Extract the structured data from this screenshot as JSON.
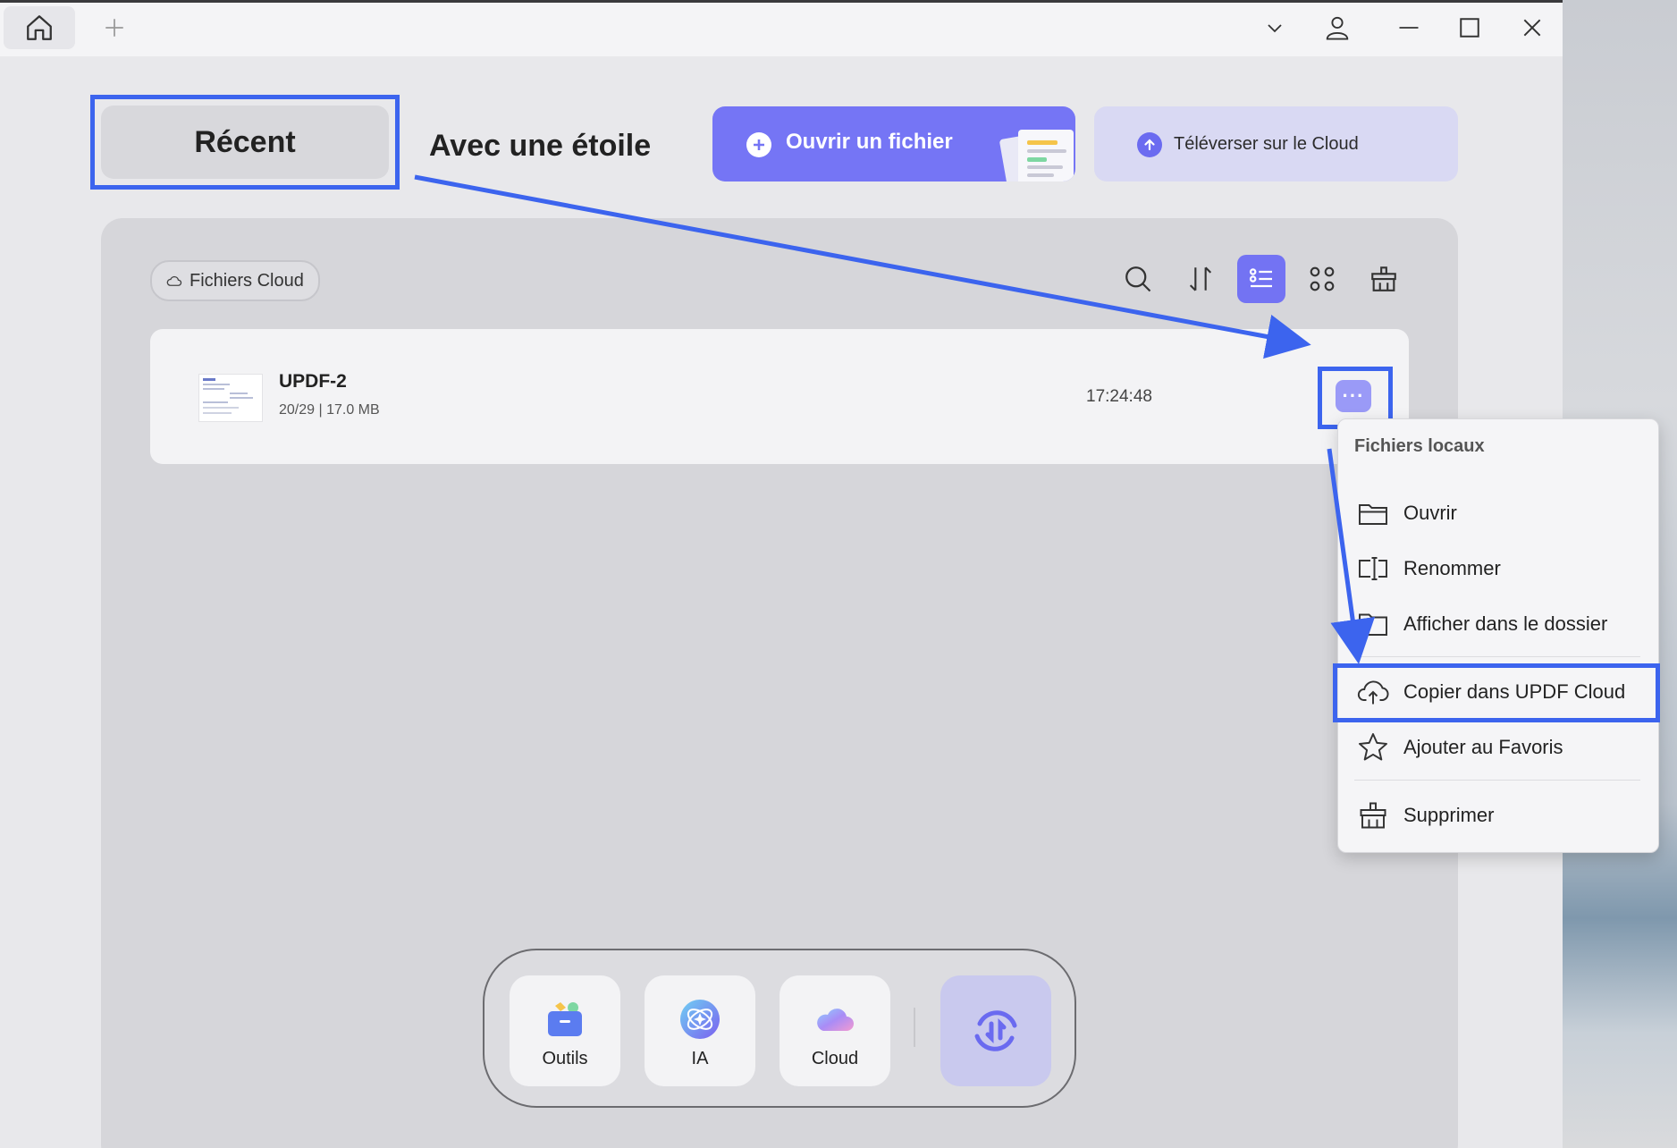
{
  "tabs": {
    "recent": "Récent",
    "starred": "Avec une étoile"
  },
  "actions": {
    "open_file": "Ouvrir un fichier",
    "upload_cloud": "Téléverser sur le Cloud"
  },
  "filter_chip": "Fichiers Cloud",
  "toolbar": {
    "icons": [
      "search-icon",
      "sort-icon",
      "list-view-icon",
      "grid-view-icon",
      "clear-icon"
    ],
    "active_view": "list"
  },
  "files": [
    {
      "name": "UPDF-2",
      "meta": "20/29 | 17.0 MB",
      "time": "17:24:48",
      "more_label": "···"
    }
  ],
  "context_menu": {
    "header": "Fichiers locaux",
    "items": [
      {
        "label": "Ouvrir",
        "icon": "folder-open-icon"
      },
      {
        "label": "Renommer",
        "icon": "rename-icon"
      },
      {
        "label": "Afficher dans le dossier",
        "icon": "folder-icon"
      },
      {
        "label": "Copier dans UPDF Cloud",
        "icon": "cloud-upload-icon"
      },
      {
        "label": "Ajouter au Favoris",
        "icon": "star-icon"
      },
      {
        "label": "Supprimer",
        "icon": "trash-icon"
      }
    ],
    "highlighted_item": "Copier dans UPDF Cloud"
  },
  "dock": {
    "items": [
      {
        "label": "Outils",
        "icon": "tools-icon"
      },
      {
        "label": "IA",
        "icon": "ai-icon"
      },
      {
        "label": "Cloud",
        "icon": "cloud-icon"
      }
    ],
    "converter_icon": "convert-icon"
  },
  "colors": {
    "accent": "#7575f5",
    "annotation": "#3c64ee",
    "upload_bg": "#d9d9f3"
  }
}
